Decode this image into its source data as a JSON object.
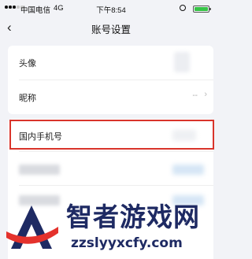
{
  "status_bar": {
    "carrier": "中国电信",
    "network": "4G",
    "time": "下午8:54",
    "battery_color": "#36c446"
  },
  "nav": {
    "back_icon": "chevron-left-icon",
    "title": "账号设置"
  },
  "rows": {
    "avatar_label": "头像",
    "nickname_label": "昵称",
    "nickname_value": "--",
    "phone_label": "国内手机号"
  },
  "highlight_color": "#d9342b",
  "watermark": {
    "title": "智者游戏网",
    "url": "zzslyyxcfy.com"
  }
}
